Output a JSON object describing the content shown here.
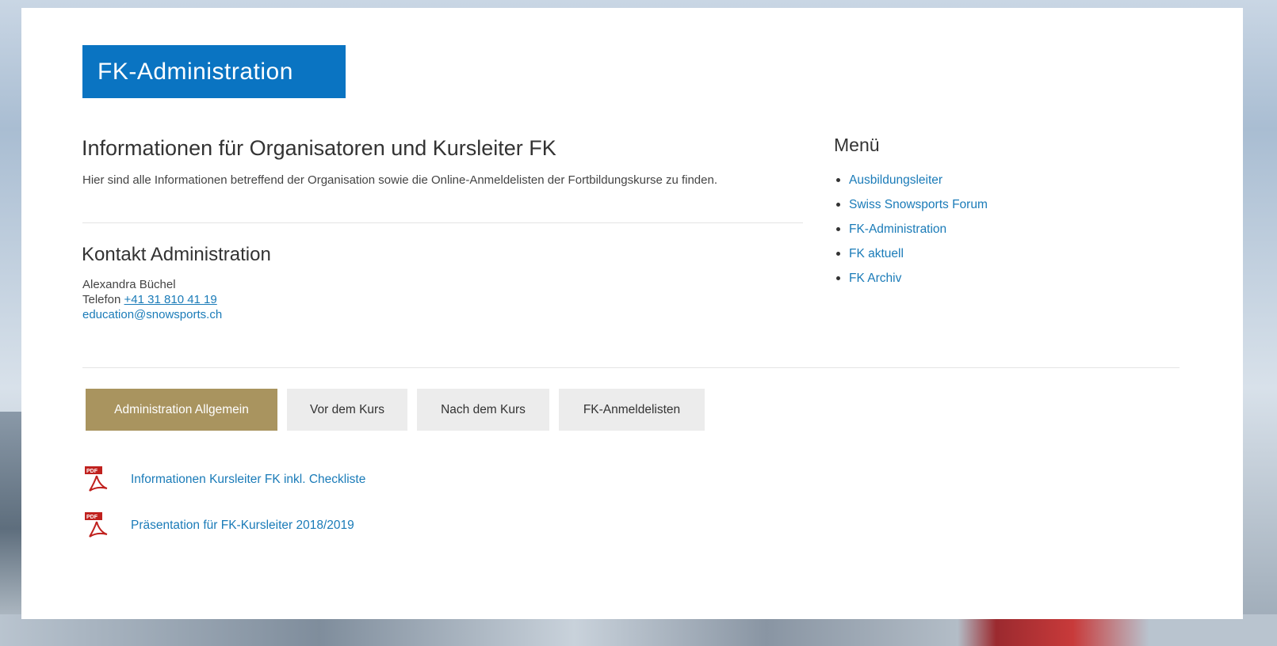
{
  "brand": {
    "title": "FK-Administration",
    "color": "#0a74c2"
  },
  "intro": {
    "title": "Informationen für Organisatoren und Kursleiter FK",
    "text": "Hier sind alle Informationen betreffend der Organisation sowie die Online-Anmeldelisten der Fortbildungskurse zu finden."
  },
  "contact": {
    "title": "Kontakt Administration",
    "name": "Alexandra Büchel",
    "phone_label": "Telefon",
    "phone": "+41 31 810 41 19",
    "email": "education@snowsports.ch"
  },
  "menu": {
    "title": "Menü",
    "items": [
      {
        "label": "Ausbildungsleiter"
      },
      {
        "label": "Swiss Snowsports Forum"
      },
      {
        "label": "FK-Administration"
      },
      {
        "label": "FK aktuell"
      },
      {
        "label": "FK Archiv"
      }
    ]
  },
  "tabs": [
    {
      "label": "Administration Allgemein",
      "active": true
    },
    {
      "label": "Vor dem Kurs",
      "active": false
    },
    {
      "label": "Nach dem Kurs",
      "active": false
    },
    {
      "label": "FK-Anmeldelisten",
      "active": false
    }
  ],
  "documents": [
    {
      "label": "Informationen Kursleiter FK inkl. Checkliste",
      "icon": "pdf-icon"
    },
    {
      "label": "Präsentation für FK-Kursleiter 2018/2019",
      "icon": "pdf-icon"
    }
  ],
  "colors": {
    "accent": "#0a74c2",
    "active_tab": "#a9945f",
    "link": "#1a7bb8"
  }
}
